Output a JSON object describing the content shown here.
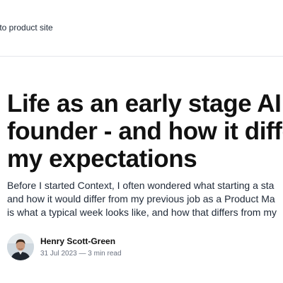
{
  "nav": {
    "back_label": "k to product site"
  },
  "article": {
    "title_lines": [
      "Life as an early stage AI s",
      "founder - and how it diffe",
      "my expectations"
    ],
    "intro_lines": [
      "Before I started Context, I often wondered what starting a sta",
      "and how it would differ from my previous job as a Product Ma",
      "is what a typical week looks like, and how that differs from my"
    ]
  },
  "author": {
    "name": "Henry Scott-Green",
    "date": "31 Jul 2023",
    "separator": "—",
    "read_time": "3 min read"
  }
}
